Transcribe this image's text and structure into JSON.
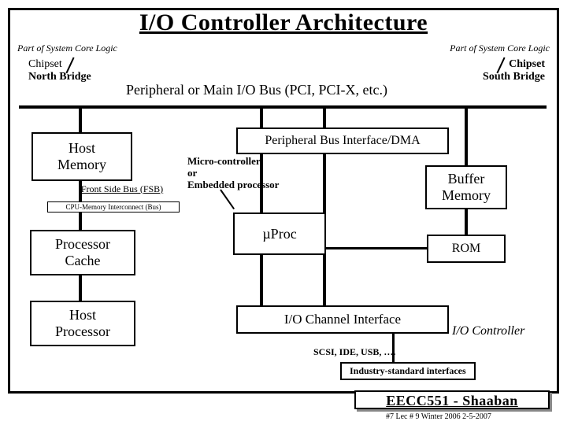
{
  "title": "I/O Controller Architecture",
  "labels": {
    "part_left": "Part of System Core Logic",
    "part_right": "Part of System Core Logic",
    "chipset": "Chipset",
    "north": "North Bridge",
    "south": "South Bridge",
    "pci_bus": "Peripheral or Main I/O Bus (PCI, PCI-X, etc.)",
    "host_memory": "Host\nMemory",
    "fsb": "Front Side Bus (FSB)",
    "cpu_mem": "CPU-Memory Interconnect (Bus)",
    "proc_cache": "Processor\nCache",
    "host_proc": "Host\nProcessor",
    "pbi": "Peripheral Bus Interface/DMA",
    "microcontroller": "Micro-controller\nor\nEmbedded processor",
    "mproc": "µProc",
    "buffer": "Buffer\nMemory",
    "rom": "ROM",
    "io_channel": "I/O Channel Interface",
    "io_controller": "I/O Controller",
    "scsi": "SCSI, IDE, USB,  ….",
    "industry": "Industry-standard interfaces"
  },
  "footer": {
    "course": "EECC551 - Shaaban",
    "note": "#7   Lec # 9   Winter 2006  2-5-2007"
  }
}
